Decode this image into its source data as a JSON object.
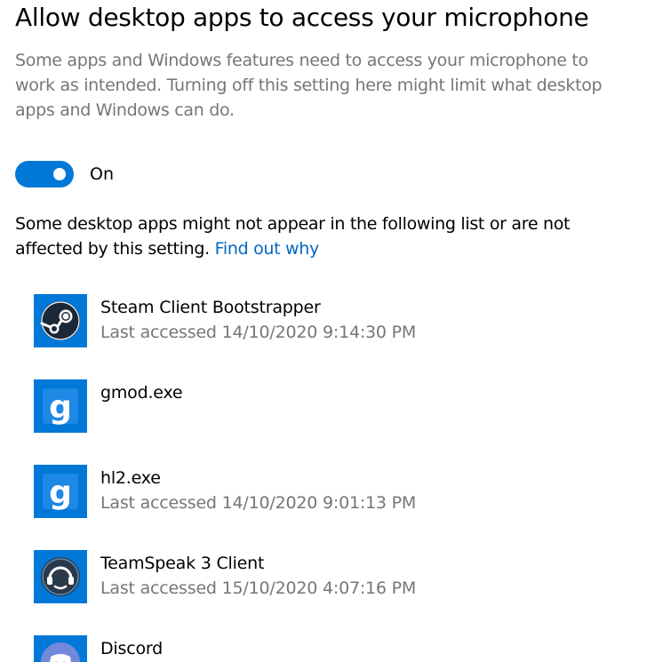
{
  "page": {
    "title": "Allow desktop apps to access your microphone",
    "description": "Some apps and Windows features need to access your microphone to work as intended. Turning off this setting here might limit what desktop apps and Windows can do."
  },
  "toggle": {
    "state": "On",
    "checked": true,
    "accent": "#0078d7"
  },
  "note": {
    "text": "Some desktop apps might not appear in the following list or are not affected by this setting.",
    "link": "Find out why"
  },
  "apps": [
    {
      "name": "Steam Client Bootstrapper",
      "accessed": "Last accessed 14/10/2020 9:14:30 PM",
      "icon": "steam-icon"
    },
    {
      "name": "gmod.exe",
      "accessed": "",
      "icon": "gmod-icon"
    },
    {
      "name": "hl2.exe",
      "accessed": "Last accessed 14/10/2020 9:01:13 PM",
      "icon": "gmod-icon"
    },
    {
      "name": "TeamSpeak 3 Client",
      "accessed": "Last accessed 15/10/2020 4:07:16 PM",
      "icon": "teamspeak-icon"
    },
    {
      "name": "Discord",
      "accessed": "",
      "icon": "discord-icon"
    }
  ],
  "colors": {
    "accent": "#0078d7",
    "link": "#0067c0",
    "secondary_text": "#767676"
  }
}
